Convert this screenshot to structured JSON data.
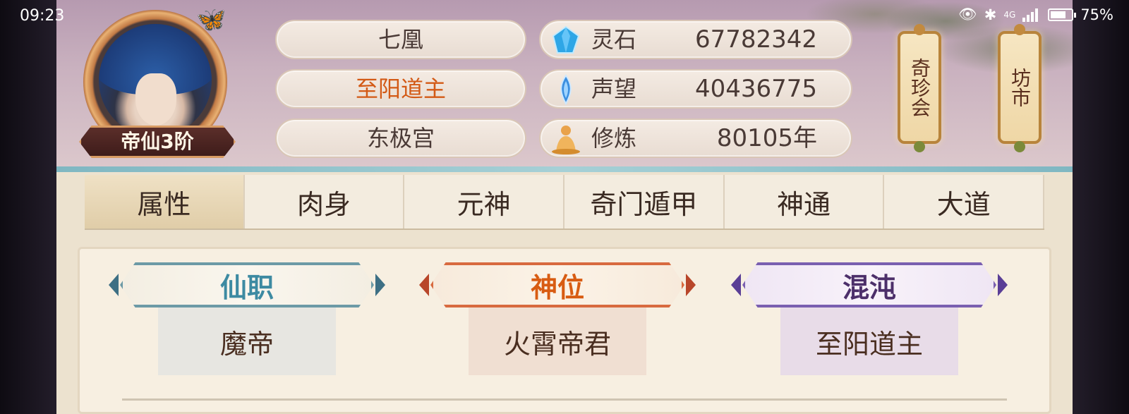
{
  "status_bar": {
    "time": "09:23",
    "battery": "75%",
    "battery_level": 0.75,
    "network": "4G"
  },
  "profile": {
    "rank_badge": "帝仙3阶",
    "name": "七凰",
    "title": "至阳道主",
    "sect": "东极宫"
  },
  "resources": [
    {
      "icon": "spirit-stone-icon",
      "label": "灵石",
      "value": "67782342"
    },
    {
      "icon": "reputation-icon",
      "label": "声望",
      "value": "40436775"
    },
    {
      "icon": "cultivation-icon",
      "label": "修炼",
      "value": "80105年"
    }
  ],
  "lanterns": [
    {
      "label": "奇珍会"
    },
    {
      "label": "坊市"
    }
  ],
  "tabs": [
    {
      "label": "属性",
      "active": true
    },
    {
      "label": "肉身",
      "active": false
    },
    {
      "label": "元神",
      "active": false
    },
    {
      "label": "奇门遁甲",
      "active": false
    },
    {
      "label": "神通",
      "active": false
    },
    {
      "label": "大道",
      "active": false
    }
  ],
  "cards": [
    {
      "header": "仙职",
      "value": "魔帝",
      "accent": "#3d8aa2"
    },
    {
      "header": "神位",
      "value": "火霄帝君",
      "accent": "#d85c12"
    },
    {
      "header": "混沌",
      "value": "至阳道主",
      "accent": "#4c2f6a"
    }
  ]
}
